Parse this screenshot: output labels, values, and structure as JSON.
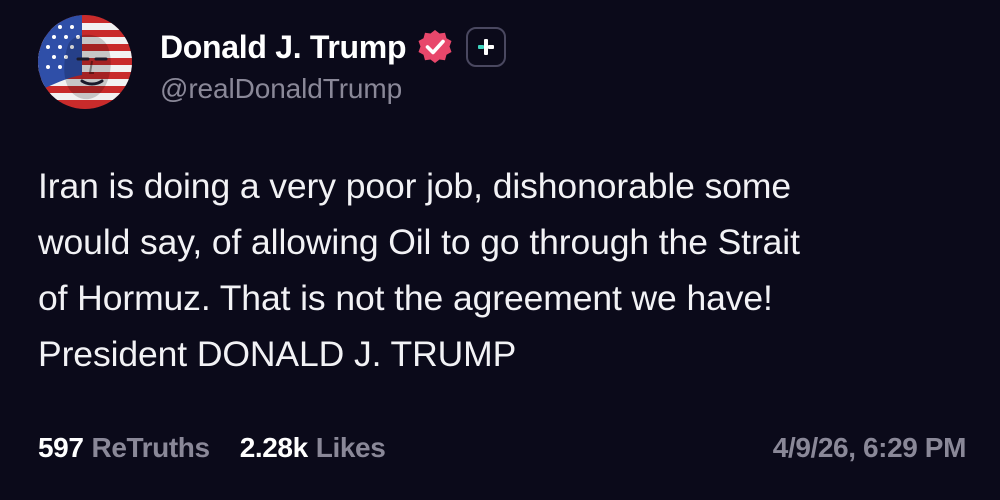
{
  "author": {
    "display_name": "Donald J. Trump",
    "handle": "@realDonaldTrump",
    "verified_icon": "verified-badge-icon",
    "plus_icon": "plus-icon"
  },
  "post": {
    "lines": [
      "Iran is doing a very poor job, dishonorable some",
      "would say, of allowing Oil to go through the Strait",
      "of Hormuz. That is not the agreement we have!",
      "President DONALD J. TRUMP"
    ]
  },
  "stats": {
    "retruths_count": "597",
    "retruths_label": "ReTruths",
    "likes_count": "2.28k",
    "likes_label": "Likes"
  },
  "timestamp": "4/9/26, 6:29 PM",
  "colors": {
    "background": "#0b0a1a",
    "text": "#ffffff",
    "muted": "#8a8898",
    "verified": "#e8476b",
    "plus_accent": "#3fd6c0"
  }
}
